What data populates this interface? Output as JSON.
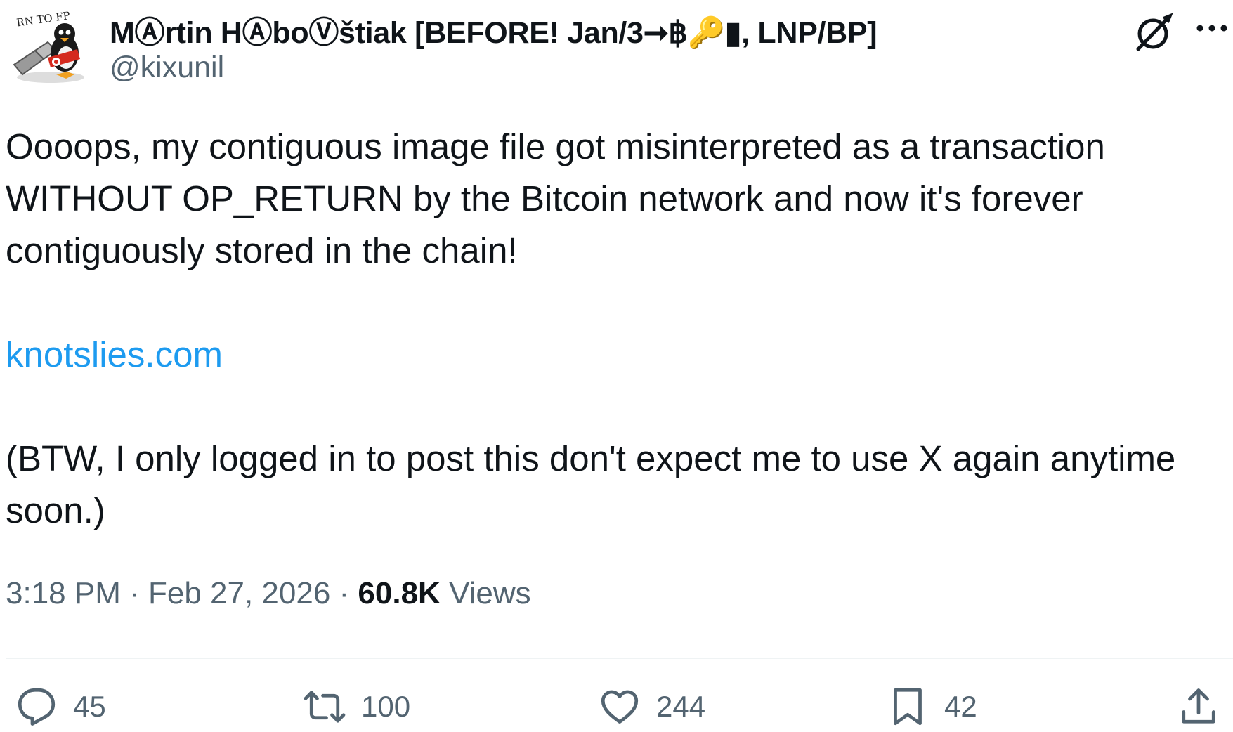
{
  "author": {
    "display_name": "MⒶrtin HⒶboⓋštiak [BEFORE! Jan/3➞฿🔑▮, LNP/BP]",
    "handle": "@kixunil",
    "avatar_caption": "RN TO FP"
  },
  "tweet": {
    "paragraphs": [
      "Oooops, my contiguous image file got misinterpreted as a transaction",
      "WITHOUT OP_RETURN by the Bitcoin network and now it's forever",
      "contiguously stored in the chain!"
    ],
    "link": "knotslies.com",
    "footer_line1": "(BTW, I only logged in to post this don't expect me to use X again anytime",
    "footer_line2": "soon.)"
  },
  "meta": {
    "time": "3:18 PM",
    "sep1": " · ",
    "date": "Feb 27, 2026",
    "sep2": " · ",
    "views_count": "60.8K",
    "views_label": " Views"
  },
  "actions": {
    "replies": "45",
    "reposts": "100",
    "likes": "244",
    "bookmarks": "42"
  },
  "icons": {
    "grok": "slashed-circle-icon",
    "more": "more-icon",
    "reply": "reply-icon",
    "repost": "repost-icon",
    "like": "heart-icon",
    "bookmark": "bookmark-icon",
    "share": "share-icon"
  },
  "colors": {
    "link": "#1d9bf0",
    "secondary_text": "#536471",
    "primary_text": "#0f1419"
  }
}
